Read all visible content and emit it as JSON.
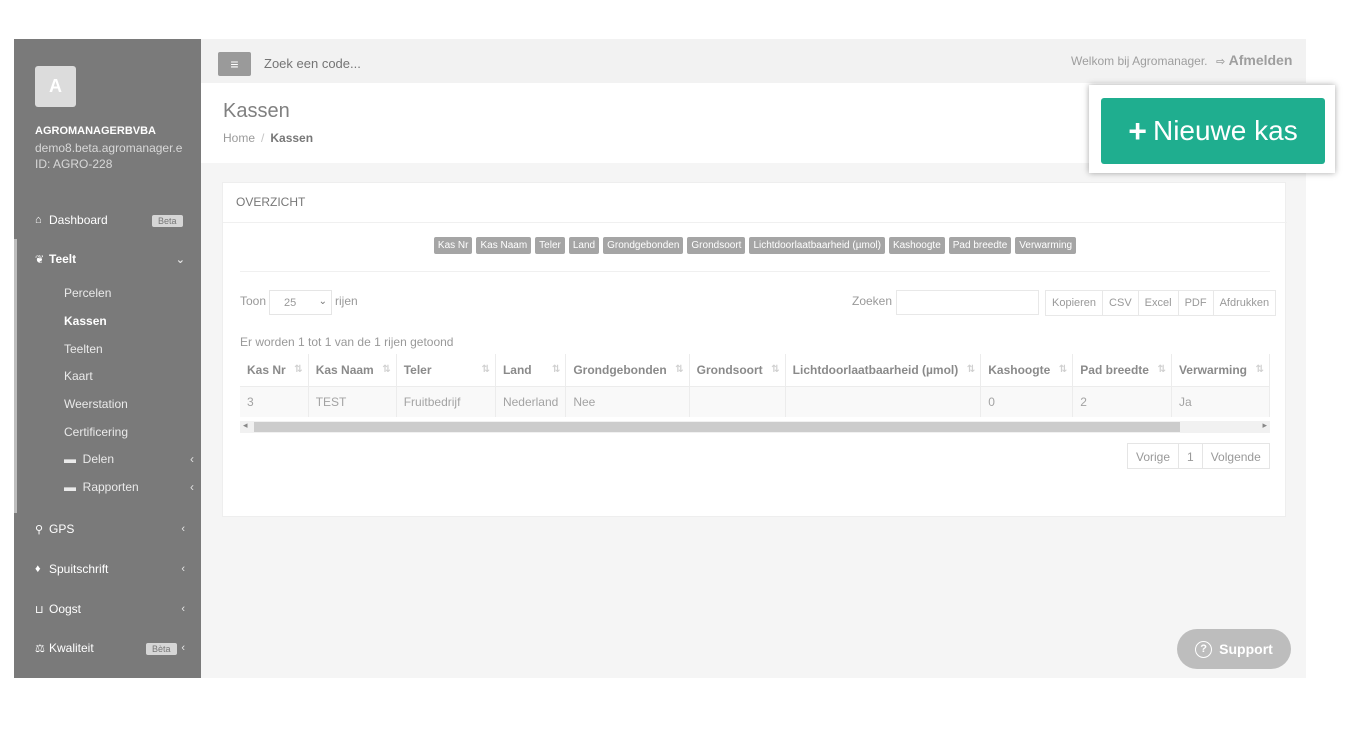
{
  "sidebar": {
    "avatar_letter": "A",
    "company": "AGROMANAGERBVBA",
    "domain": "demo8.beta.agromanager.e",
    "account_id": "ID: AGRO-228",
    "dashboard": {
      "label": "Dashboard",
      "badge": "Beta"
    },
    "teelt": {
      "label": "Teelt"
    },
    "sub_items": [
      "Percelen",
      "Kassen",
      "Teelten",
      "Kaart",
      "Weerstation",
      "Certificering"
    ],
    "delen": "Delen",
    "rapporten": "Rapporten",
    "gps": "GPS",
    "spuitschrift": "Spuitschrift",
    "oogst": "Oogst",
    "kwaliteit": {
      "label": "Kwaliteit",
      "badge": "Bèta"
    }
  },
  "topbar": {
    "search_placeholder": "Zoek een code...",
    "welcome": "Welkom bij Agromanager.",
    "logout": "Afmelden"
  },
  "header": {
    "title": "Kassen",
    "breadcrumb_home": "Home",
    "breadcrumb_current": "Kassen"
  },
  "new_button": {
    "label": "Nieuwe kas"
  },
  "panel": {
    "title": "OVERZICHT",
    "column_toggles": [
      "Kas Nr",
      "Kas Naam",
      "Teler",
      "Land",
      "Grondgebonden",
      "Grondsoort",
      "Lichtdoorlaatbaarheid (µmol)",
      "Kashoogte",
      "Pad breedte",
      "Verwarming"
    ],
    "show_label": "Toon",
    "page_size": "25",
    "rows_label": "rijen",
    "search_label": "Zoeken",
    "export_buttons": [
      "Kopieren",
      "CSV",
      "Excel",
      "PDF",
      "Afdrukken"
    ],
    "info": "Er worden 1 tot 1 van de 1 rijen getoond",
    "table": {
      "headers": [
        "Kas Nr",
        "Kas Naam",
        "Teler",
        "Land",
        "Grondgebonden",
        "Grondsoort",
        "Lichtdoorlaatbaarheid (µmol)",
        "Kashoogte",
        "Pad breedte",
        "Verwarming"
      ],
      "rows": [
        [
          "3",
          "TEST",
          "Fruitbedrijf",
          "Nederland",
          "Nee",
          "",
          "",
          "0",
          "2",
          "Ja"
        ]
      ]
    },
    "pager": {
      "prev": "Vorige",
      "page": "1",
      "next": "Volgende"
    }
  },
  "support": {
    "label": "Support"
  },
  "colors": {
    "accent": "#1fae8f",
    "sidebar": "#7a7a7a"
  }
}
